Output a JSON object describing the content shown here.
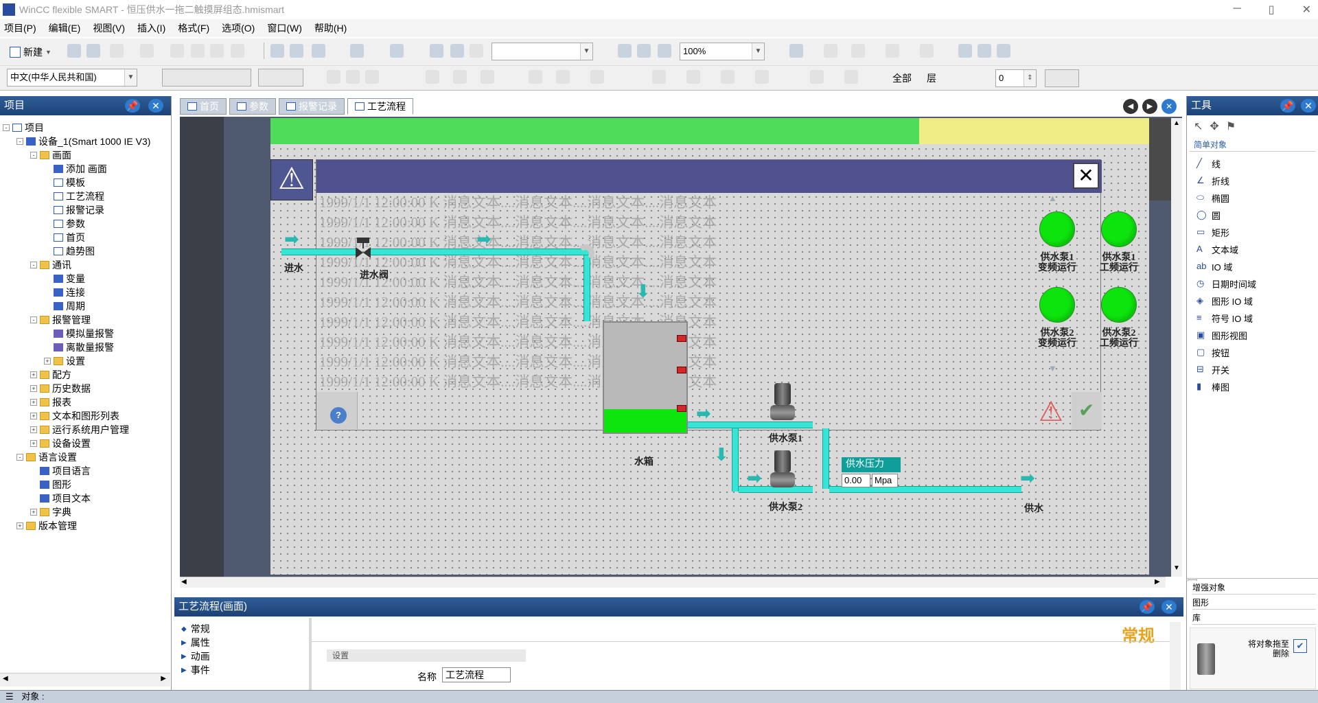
{
  "window": {
    "title": "WinCC flexible SMART - 恒压供水一拖二触摸屏组态.hmismart"
  },
  "menu": [
    "项目(P)",
    "编辑(E)",
    "视图(V)",
    "插入(I)",
    "格式(F)",
    "选项(O)",
    "窗口(W)",
    "帮助(H)"
  ],
  "toolbar": {
    "new_label": "新建",
    "zoom_value": "100%",
    "language_value": "中文(中华人民共和国)",
    "all_label": "全部",
    "layer_label": "层",
    "layer_value": "0"
  },
  "project": {
    "title": "项目",
    "items": [
      {
        "label": "项目",
        "level": 0,
        "icon": "project-icon",
        "exp": "-"
      },
      {
        "label": "设备_1(Smart 1000 IE V3)",
        "level": 1,
        "icon": "device-icon",
        "exp": "-"
      },
      {
        "label": "画面",
        "level": 2,
        "icon": "folder-icon",
        "exp": "-"
      },
      {
        "label": "添加 画面",
        "level": 3,
        "icon": "add-screen-icon"
      },
      {
        "label": "模板",
        "level": 3,
        "icon": "template-icon"
      },
      {
        "label": "工艺流程",
        "level": 3,
        "icon": "screen-icon"
      },
      {
        "label": "报警记录",
        "level": 3,
        "icon": "screen-icon"
      },
      {
        "label": "参数",
        "level": 3,
        "icon": "screen-icon"
      },
      {
        "label": "首页",
        "level": 3,
        "icon": "screen-icon"
      },
      {
        "label": "趋势图",
        "level": 3,
        "icon": "screen-icon"
      },
      {
        "label": "通讯",
        "level": 2,
        "icon": "folder-icon",
        "exp": "-"
      },
      {
        "label": "变量",
        "level": 3,
        "icon": "tags-icon"
      },
      {
        "label": "连接",
        "level": 3,
        "icon": "connection-icon"
      },
      {
        "label": "周期",
        "level": 3,
        "icon": "cycle-icon"
      },
      {
        "label": "报警管理",
        "level": 2,
        "icon": "folder-icon",
        "exp": "-"
      },
      {
        "label": "模拟量报警",
        "level": 3,
        "icon": "analog-alarm-icon"
      },
      {
        "label": "离散量报警",
        "level": 3,
        "icon": "discrete-alarm-icon"
      },
      {
        "label": "设置",
        "level": 3,
        "icon": "folder-icon",
        "exp": "+"
      },
      {
        "label": "配方",
        "level": 2,
        "icon": "folder-icon",
        "exp": "+"
      },
      {
        "label": "历史数据",
        "level": 2,
        "icon": "folder-icon",
        "exp": "+"
      },
      {
        "label": "报表",
        "level": 2,
        "icon": "folder-icon",
        "exp": "+"
      },
      {
        "label": "文本和图形列表",
        "level": 2,
        "icon": "folder-icon",
        "exp": "+"
      },
      {
        "label": "运行系统用户管理",
        "level": 2,
        "icon": "folder-icon",
        "exp": "+"
      },
      {
        "label": "设备设置",
        "level": 2,
        "icon": "folder-icon",
        "exp": "+"
      },
      {
        "label": "语言设置",
        "level": 1,
        "icon": "folder-icon",
        "exp": "-"
      },
      {
        "label": "项目语言",
        "level": 2,
        "icon": "globe-icon"
      },
      {
        "label": "图形",
        "level": 2,
        "icon": "graphics-icon"
      },
      {
        "label": "项目文本",
        "level": 2,
        "icon": "text-icon"
      },
      {
        "label": "字典",
        "level": 2,
        "icon": "folder-icon",
        "exp": "+"
      },
      {
        "label": "版本管理",
        "level": 1,
        "icon": "folder-icon",
        "exp": "+"
      }
    ]
  },
  "tabs": [
    "首页",
    "参数",
    "报警记录",
    "工艺流程"
  ],
  "active_tab": "工艺流程",
  "screen": {
    "alarm_row_text": "1999/1/1 12:00:00 K 消息文本....消息文本....消息文本....消息文本",
    "alarm_row_count": 10,
    "labels": {
      "inlet": "进水",
      "inlet_valve": "进水阀",
      "tank": "水箱",
      "pump1": "供水泵1",
      "pump2": "供水泵2",
      "supply": "供水",
      "pressure_title": "供水压力",
      "pressure_value": "0.00",
      "pressure_unit": "Mpa"
    },
    "lamps": [
      {
        "line1": "供水泵1",
        "line2": "变频运行",
        "on": true
      },
      {
        "line1": "供水泵1",
        "line2": "工频运行",
        "on": true
      },
      {
        "line1": "供水泵2",
        "line2": "变频运行",
        "on": true
      },
      {
        "line1": "供水泵2",
        "line2": "工频运行",
        "on": true
      }
    ]
  },
  "tools": {
    "title": "工具",
    "group_label": "简单对象",
    "items": [
      {
        "label": "线",
        "icon": "line-tool-icon"
      },
      {
        "label": "折线",
        "icon": "polyline-tool-icon"
      },
      {
        "label": "椭圆",
        "icon": "ellipse-tool-icon"
      },
      {
        "label": "圆",
        "icon": "circle-tool-icon"
      },
      {
        "label": "矩形",
        "icon": "rectangle-tool-icon"
      },
      {
        "label": "文本域",
        "icon": "text-field-tool-icon"
      },
      {
        "label": "IO 域",
        "icon": "io-field-tool-icon"
      },
      {
        "label": "日期时间域",
        "icon": "datetime-tool-icon"
      },
      {
        "label": "图形 IO 域",
        "icon": "graphic-io-tool-icon"
      },
      {
        "label": "符号 IO 域",
        "icon": "symbolic-io-tool-icon"
      },
      {
        "label": "图形视图",
        "icon": "graphic-view-tool-icon"
      },
      {
        "label": "按钮",
        "icon": "button-tool-icon"
      },
      {
        "label": "开关",
        "icon": "switch-tool-icon"
      },
      {
        "label": "棒图",
        "icon": "bar-tool-icon"
      }
    ],
    "sections": [
      "增强对象",
      "图形",
      "库"
    ],
    "delete_hint": "将对象拖至\n删除"
  },
  "properties": {
    "title": "工艺流程(画面)",
    "nav": [
      "常规",
      "属性",
      "动画",
      "事件"
    ],
    "heading": "常规",
    "group": "设置",
    "name_label": "名称",
    "name_value": "工艺流程"
  },
  "status": {
    "object_label": "对象 :"
  }
}
